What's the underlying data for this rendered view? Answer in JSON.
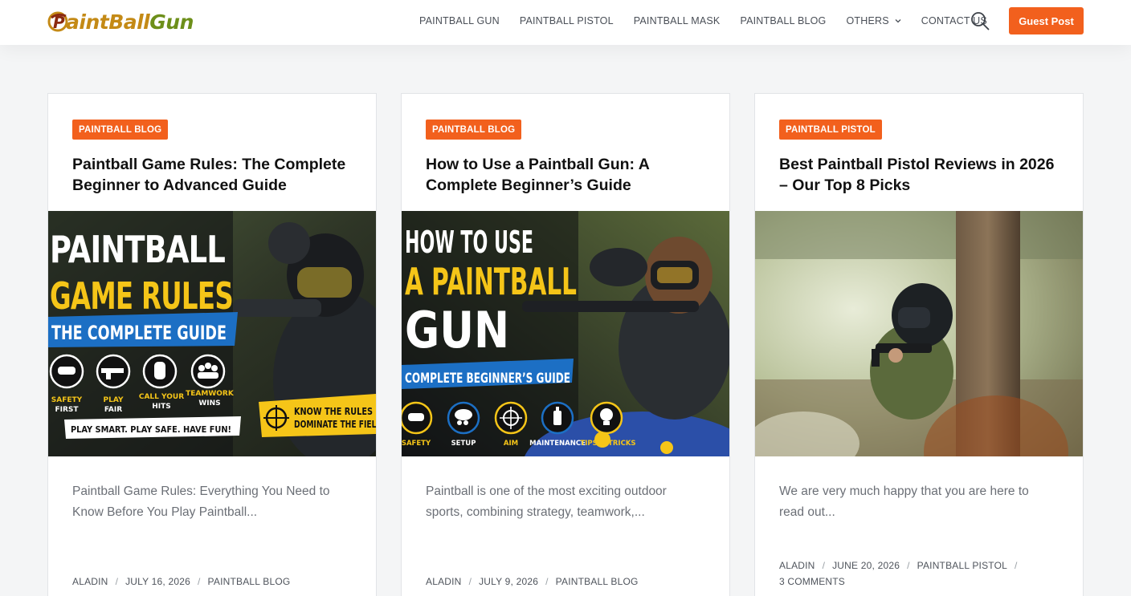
{
  "brand": {
    "logo_first": "P",
    "logo_main": "aintBall",
    "logo_sub": "Gun",
    "accent": "#f2601d"
  },
  "nav": {
    "items": [
      "PAINTBALL GUN",
      "PAINTBALL PISTOL",
      "PAINTBALL MASK",
      "PAINTBALL BLOG",
      "OTHERS",
      "CONTACT US"
    ],
    "search_icon": "search-icon",
    "guest_post": "Guest Post"
  },
  "cards": [
    {
      "category": "PAINTBALL BLOG",
      "title": "Paintball Game Rules: The Complete Beginner to Advanced Guide",
      "image": {
        "line1": "PAINTBALL",
        "line2": "GAME RULES",
        "line3": "THE COMPLETE GUIDE",
        "icons": [
          {
            "icon": "mask-icon",
            "label1": "SAFETY",
            "label2": "FIRST"
          },
          {
            "icon": "marker-icon",
            "label1": "PLAY",
            "label2": "FAIR"
          },
          {
            "icon": "hand-icon",
            "label1": "CALL YOUR",
            "label2": "HITS"
          },
          {
            "icon": "team-icon",
            "label1": "TEAMWORK",
            "label2": "WINS"
          }
        ],
        "banner1": "KNOW THE RULES",
        "banner2": "DOMINATE THE FIELD",
        "tagline": "PLAY SMART. PLAY SAFE. HAVE FUN!"
      },
      "excerpt": "Paintball Game Rules: Everything You Need to Know Before You Play Paintball...",
      "meta": {
        "author": "ALADIN",
        "date": "JULY 16, 2026",
        "category": "PAINTBALL BLOG"
      }
    },
    {
      "category": "PAINTBALL BLOG",
      "title": "How to Use a Paintball Gun: A Complete Beginner’s Guide",
      "image": {
        "line1": "HOW TO USE",
        "line2": "A PAINTBALL",
        "line3": "GUN",
        "banner": "COMPLETE BEGINNER’S GUIDE",
        "icons": [
          {
            "icon": "mask-icon",
            "label": "SAFETY"
          },
          {
            "icon": "hopper-icon",
            "label": "SETUP"
          },
          {
            "icon": "crosshair-icon",
            "label": "AIM"
          },
          {
            "icon": "bottle-icon",
            "label": "MAINTENANCE"
          },
          {
            "icon": "bulb-icon",
            "label": "TIPS & TRICKS"
          }
        ]
      },
      "excerpt": "Paintball is one of the most exciting outdoor sports, combining strategy, teamwork,...",
      "meta": {
        "author": "ALADIN",
        "date": "JULY 9, 2026",
        "category": "PAINTBALL BLOG"
      }
    },
    {
      "category": "PAINTBALL PISTOL",
      "title": "Best Paintball Pistol Reviews in 2026 – Our Top 8 Picks",
      "excerpt": "We are very much happy that you are here to read out...",
      "meta": {
        "author": "ALADIN",
        "date": "JUNE 20, 2026",
        "category": "PAINTBALL PISTOL",
        "comments": "3 COMMENTS"
      }
    }
  ]
}
